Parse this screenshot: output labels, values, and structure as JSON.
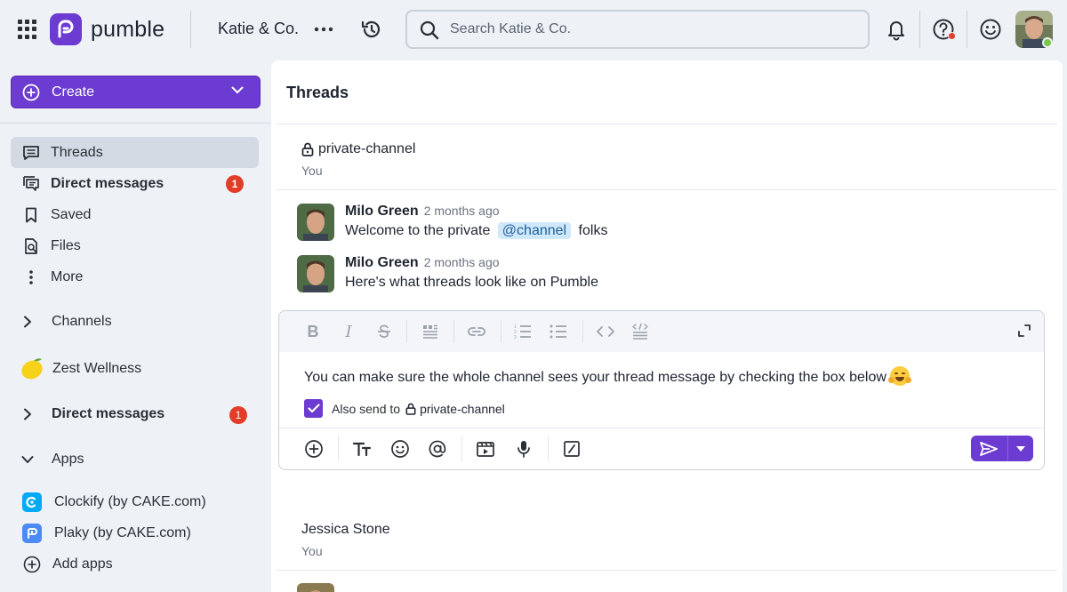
{
  "brand": {
    "name": "pumble",
    "accent": "#6c3bd1"
  },
  "topbar": {
    "workspace": "Katie & Co.",
    "search_placeholder": "Search Katie & Co."
  },
  "sidebar": {
    "create_label": "Create",
    "nav": [
      {
        "label": "Threads",
        "icon": "threads-icon"
      },
      {
        "label": "Direct messages",
        "icon": "direct-messages-icon",
        "badge": "1"
      },
      {
        "label": "Saved",
        "icon": "bookmark-icon"
      },
      {
        "label": "Files",
        "icon": "files-icon"
      },
      {
        "label": "More",
        "icon": "more-vertical-icon"
      }
    ],
    "channels_label": "Channels",
    "zest_label": "Zest Wellness",
    "dm_section": {
      "label": "Direct messages",
      "badge": "1"
    },
    "apps_label": "Apps",
    "apps": [
      {
        "label": "Clockify (by CAKE.com)"
      },
      {
        "label": "Plaky (by CAKE.com)"
      }
    ],
    "add_apps_label": "Add apps"
  },
  "main": {
    "title": "Threads",
    "thread1": {
      "channel": "private-channel",
      "sub": "You",
      "messages": [
        {
          "name": "Milo Green",
          "time": "2 months ago",
          "before": "Welcome to the private",
          "mention": "@channel",
          "after": "folks"
        },
        {
          "name": "Milo Green",
          "time": "2 months ago",
          "text": "Here's what threads look like on Pumble"
        }
      ]
    },
    "composer": {
      "text": "You can make sure the whole channel sees your thread message by checking the box below",
      "also_label": "Also send to",
      "also_channel": "private-channel",
      "checked": true
    },
    "thread2": {
      "title": "Jessica Stone",
      "sub": "You"
    }
  }
}
